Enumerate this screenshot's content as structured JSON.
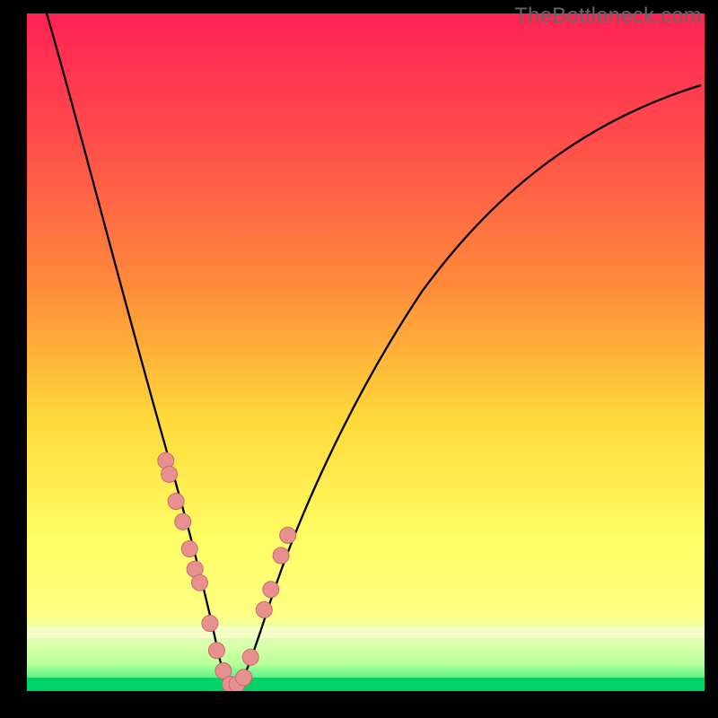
{
  "watermark": "TheBottleneck.com",
  "colors": {
    "frame": "#000000",
    "curve": "#000000",
    "marker_fill": "#e88f8f",
    "marker_stroke": "#c86a6a",
    "gradient_top": "#ff2255",
    "gradient_mid1": "#ff8a3a",
    "gradient_mid2": "#ffd93a",
    "gradient_mid3": "#ffff66",
    "gradient_band_light": "#eaffab",
    "gradient_bottom": "#00e676"
  },
  "chart_data": {
    "type": "line",
    "title": "",
    "xlabel": "",
    "ylabel": "",
    "xlim": [
      0,
      100
    ],
    "ylim": [
      0,
      100
    ],
    "series": [
      {
        "name": "bottleneck-curve",
        "x": [
          3,
          5,
          8,
          11,
          14,
          17,
          20,
          22,
          24,
          26,
          27,
          28,
          29,
          29.5,
          30,
          31,
          32,
          33,
          34,
          36,
          39,
          43,
          48,
          54,
          61,
          69,
          78,
          88,
          99.5
        ],
        "y": [
          100,
          91,
          79,
          68,
          57,
          46,
          36,
          28,
          21,
          14,
          10,
          6,
          3,
          1.5,
          0.5,
          0.5,
          2,
          5,
          9,
          15,
          24,
          34,
          44,
          53,
          62,
          69,
          75,
          80,
          84
        ]
      }
    ],
    "markers": {
      "name": "highlight-points",
      "x_approx": [
        20.5,
        21,
        22,
        23,
        24,
        24.8,
        25.5,
        27,
        28,
        29,
        30,
        31,
        32,
        33,
        35,
        36,
        37.5,
        38.5
      ],
      "y_approx": [
        34,
        32,
        28,
        25,
        21,
        18,
        16,
        10,
        6,
        3,
        1,
        1,
        2,
        5,
        12,
        15,
        20,
        23
      ]
    },
    "annotations": []
  }
}
